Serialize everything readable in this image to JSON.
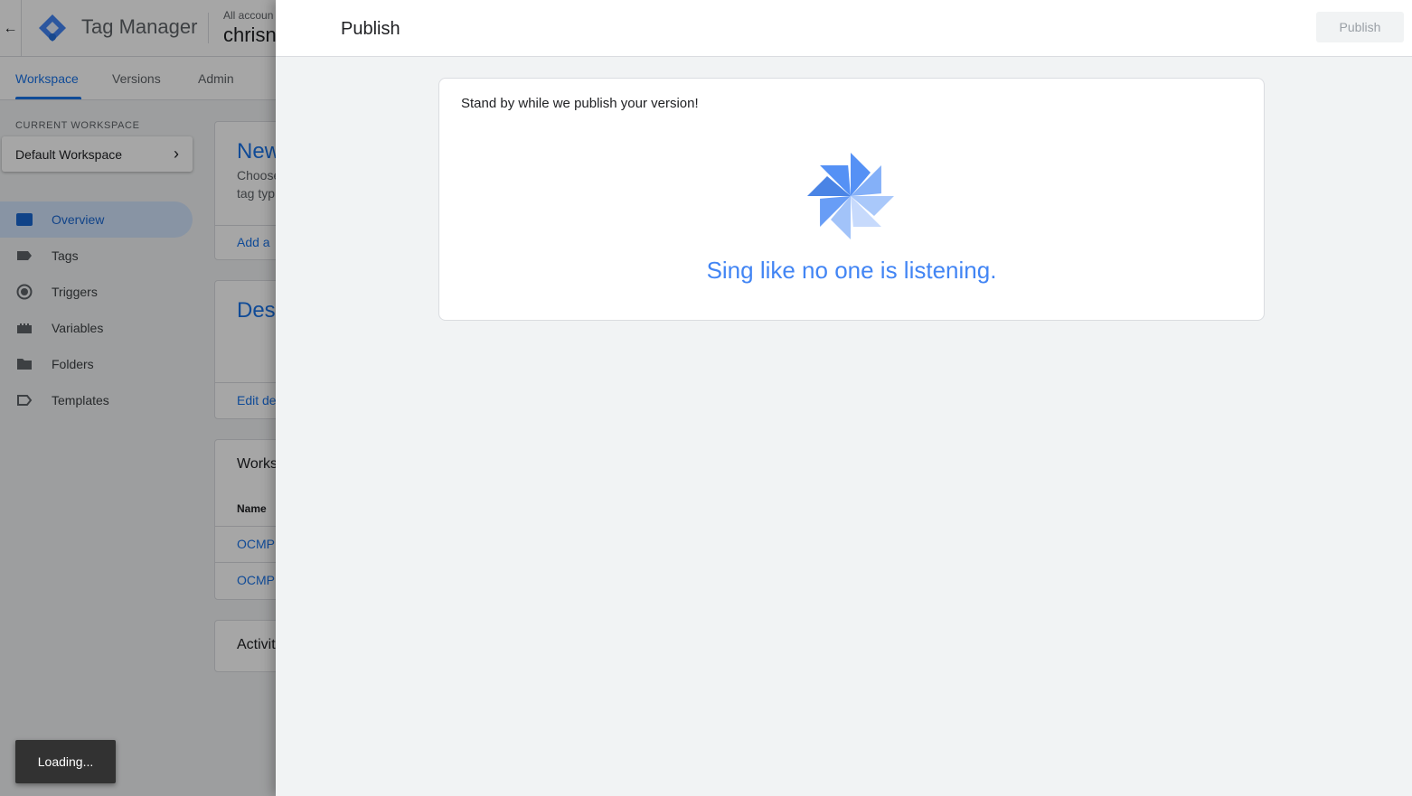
{
  "header": {
    "back_icon": "arrow-left-icon",
    "app_name": "Tag Manager",
    "account_path": "All accoun",
    "container_name": "chrisn"
  },
  "tabs": [
    {
      "label": "Workspace",
      "active": true
    },
    {
      "label": "Versions",
      "active": false
    },
    {
      "label": "Admin",
      "active": false
    }
  ],
  "sidebar": {
    "current_workspace_label": "CURRENT WORKSPACE",
    "workspace_name": "Default Workspace",
    "items": [
      {
        "label": "Overview",
        "icon": "overview-icon",
        "active": true
      },
      {
        "label": "Tags",
        "icon": "tag-icon",
        "active": false
      },
      {
        "label": "Triggers",
        "icon": "trigger-icon",
        "active": false
      },
      {
        "label": "Variables",
        "icon": "variables-icon",
        "active": false
      },
      {
        "label": "Folders",
        "icon": "folder-icon",
        "active": false
      },
      {
        "label": "Templates",
        "icon": "template-icon",
        "active": false
      }
    ]
  },
  "cards": {
    "new_tag": {
      "title": "New",
      "line1": "Choose",
      "line2": "tag typ",
      "link": "Add a"
    },
    "description": {
      "title": "Desc",
      "link": "Edit de"
    },
    "workspace_changes": {
      "heading": "Works",
      "column": "Name",
      "rows": [
        "OCMP",
        "OCMP"
      ]
    },
    "activity": {
      "heading": "Activit"
    }
  },
  "toast": {
    "text": "Loading..."
  },
  "publish_panel": {
    "title": "Publish",
    "publish_button": "Publish",
    "status_message": "Stand by while we publish your version!",
    "tagline": "Sing like no one is listening.",
    "accent_color": "#4285f4"
  }
}
